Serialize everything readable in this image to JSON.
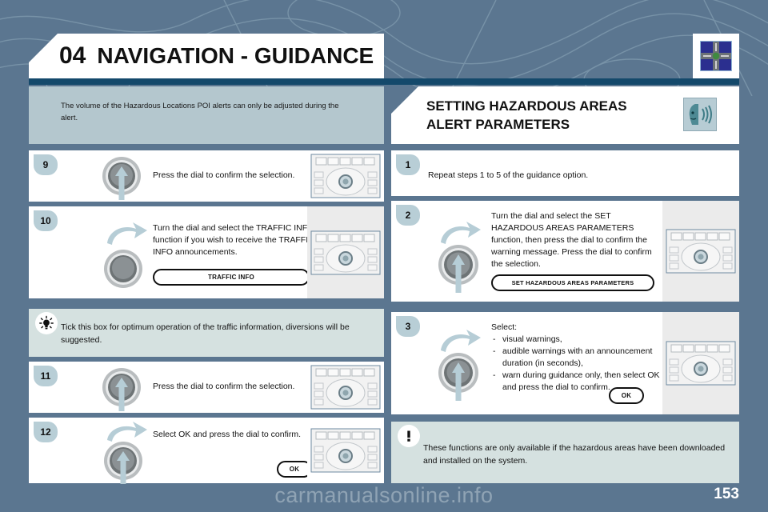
{
  "header": {
    "chapter_number": "04",
    "chapter_title": "NAVIGATION - GUIDANCE",
    "nav_logo_name": "navigation-junction-icon"
  },
  "intro": {
    "text": "The volume of the Hazardous Locations POI alerts can only be adjusted during the alert."
  },
  "section": {
    "title_line1": "SETTING HAZARDOUS AREAS",
    "title_line2": "ALERT PARAMETERS",
    "icon_name": "voice-announcement-icon"
  },
  "left_column": {
    "step9": {
      "number": "9",
      "text": "Press the dial to confirm the selection.",
      "knob_action": "press"
    },
    "step10": {
      "number": "10",
      "text": "Turn the dial and select the TRAFFIC INFO function if you wish to receive the TRAFFIC INFO announcements.",
      "button_label": "TRAFFIC INFO",
      "knob_action": "turn"
    },
    "tip": {
      "icon_name": "lightbulb-icon",
      "text": "Tick this box for optimum operation of the traffic information, diversions will be suggested."
    },
    "step11": {
      "number": "11",
      "text": "Press the dial to confirm the selection.",
      "knob_action": "press"
    },
    "step12": {
      "number": "12",
      "text": "Select OK and press the dial to confirm.",
      "button_label": "OK",
      "knob_action": "turn-press"
    }
  },
  "right_column": {
    "step1": {
      "number": "1",
      "text": "Repeat steps 1 to 5 of the guidance option."
    },
    "step2": {
      "number": "2",
      "text": "Turn the dial and select the SET HAZARDOUS AREAS PARAMETERS function, then press the dial to confirm the warning message. Press the dial to confirm the selection.",
      "button_label": "SET HAZARDOUS AREAS PARAMETERS",
      "knob_action": "turn-press"
    },
    "step3": {
      "number": "3",
      "lead": "Select:",
      "items": [
        "visual warnings,",
        "audible warnings with an announcement duration (in seconds),",
        "warn during guidance only, then select OK and press the dial to confirm."
      ],
      "button_label": "OK",
      "knob_action": "turn-press"
    },
    "warning": {
      "icon_name": "exclamation-icon",
      "text": "These functions are only available if the hazardous areas have been downloaded and installed on the system."
    }
  },
  "footer": {
    "watermark": "carmanualsonline.info",
    "page_number": "153"
  },
  "colors": {
    "page_background": "#5b7690",
    "rule_blue": "#14496b",
    "intro_blue": "#b4c7ce",
    "tip_green": "#d5e1e0",
    "badge_blue": "#b8ced6",
    "shot_grey": "#ebebeb"
  }
}
